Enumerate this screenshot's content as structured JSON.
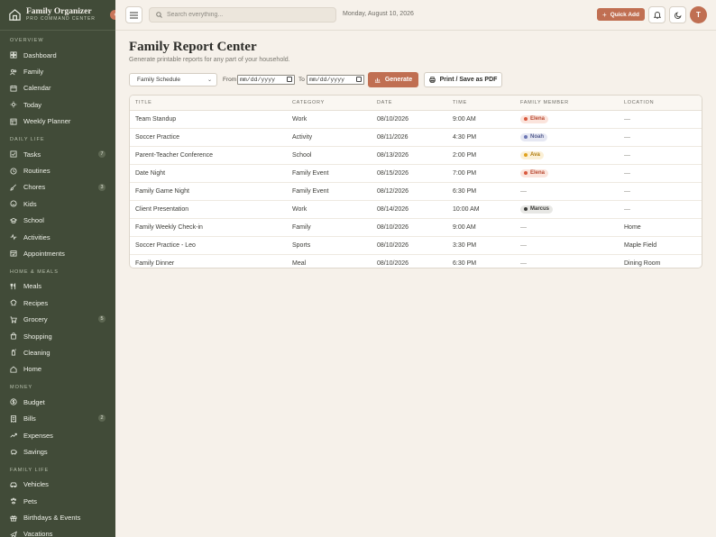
{
  "brand": {
    "title": "Family Organizer",
    "subtitle": "PRO COMMAND CENTER"
  },
  "sidebar": {
    "sections": [
      {
        "label": "OVERVIEW",
        "items": [
          {
            "label": "Dashboard",
            "icon": "grid-icon"
          },
          {
            "label": "Family",
            "icon": "users-icon"
          },
          {
            "label": "Calendar",
            "icon": "calendar-icon"
          },
          {
            "label": "Today",
            "icon": "sun-icon"
          },
          {
            "label": "Weekly Planner",
            "icon": "planner-icon"
          }
        ]
      },
      {
        "label": "DAILY LIFE",
        "items": [
          {
            "label": "Tasks",
            "icon": "checkbox-icon",
            "badge": "7"
          },
          {
            "label": "Routines",
            "icon": "clock-icon"
          },
          {
            "label": "Chores",
            "icon": "brush-icon",
            "badge": "3"
          },
          {
            "label": "Kids",
            "icon": "smile-icon"
          },
          {
            "label": "School",
            "icon": "school-icon"
          },
          {
            "label": "Activities",
            "icon": "activity-icon"
          },
          {
            "label": "Appointments",
            "icon": "appointment-icon"
          }
        ]
      },
      {
        "label": "HOME & MEALS",
        "items": [
          {
            "label": "Meals",
            "icon": "utensils-icon"
          },
          {
            "label": "Recipes",
            "icon": "chef-icon"
          },
          {
            "label": "Grocery",
            "icon": "cart-icon",
            "badge": "5"
          },
          {
            "label": "Shopping",
            "icon": "bag-icon"
          },
          {
            "label": "Cleaning",
            "icon": "spray-icon"
          },
          {
            "label": "Home",
            "icon": "home-icon"
          }
        ]
      },
      {
        "label": "MONEY",
        "items": [
          {
            "label": "Budget",
            "icon": "dollar-icon"
          },
          {
            "label": "Bills",
            "icon": "receipt-icon",
            "badge": "2"
          },
          {
            "label": "Expenses",
            "icon": "trending-icon"
          },
          {
            "label": "Savings",
            "icon": "piggy-icon"
          }
        ]
      },
      {
        "label": "FAMILY LIFE",
        "items": [
          {
            "label": "Vehicles",
            "icon": "car-icon"
          },
          {
            "label": "Pets",
            "icon": "paw-icon"
          },
          {
            "label": "Birthdays & Events",
            "icon": "gift-icon"
          },
          {
            "label": "Vacations",
            "icon": "plane-icon"
          }
        ]
      }
    ]
  },
  "topbar": {
    "search_placeholder": "Search everything...",
    "date": "Monday, August 10, 2026",
    "quick_add": "Quick Add",
    "avatar": "T"
  },
  "page": {
    "title": "Family Report Center",
    "subtitle": "Generate printable reports for any part of your household.",
    "report_type": "Family Schedule",
    "from_label": "From",
    "to_label": "To",
    "date_placeholder": "mm/dd/yyyy",
    "generate": "Generate",
    "print": "Print / Save as PDF"
  },
  "table": {
    "columns": [
      "TITLE",
      "CATEGORY",
      "DATE",
      "TIME",
      "FAMILY MEMBER",
      "LOCATION"
    ],
    "rows": [
      {
        "title": "Team Standup",
        "category": "Work",
        "date": "08/10/2026",
        "time": "9:00 AM",
        "member": "Elena",
        "location": "—"
      },
      {
        "title": "Soccer Practice",
        "category": "Activity",
        "date": "08/11/2026",
        "time": "4:30 PM",
        "member": "Noah",
        "location": "—"
      },
      {
        "title": "Parent-Teacher Conference",
        "category": "School",
        "date": "08/13/2026",
        "time": "2:00 PM",
        "member": "Ava",
        "location": "—"
      },
      {
        "title": "Date Night",
        "category": "Family Event",
        "date": "08/15/2026",
        "time": "7:00 PM",
        "member": "Elena",
        "location": "—"
      },
      {
        "title": "Family Game Night",
        "category": "Family Event",
        "date": "08/12/2026",
        "time": "6:30 PM",
        "member": "—",
        "location": "—"
      },
      {
        "title": "Client Presentation",
        "category": "Work",
        "date": "08/14/2026",
        "time": "10:00 AM",
        "member": "Marcus",
        "location": "—"
      },
      {
        "title": "Family Weekly Check-in",
        "category": "Family",
        "date": "08/10/2026",
        "time": "9:00 AM",
        "member": "—",
        "location": "Home"
      },
      {
        "title": "Soccer Practice - Leo",
        "category": "Sports",
        "date": "08/10/2026",
        "time": "3:30 PM",
        "member": "—",
        "location": "Maple Field"
      },
      {
        "title": "Family Dinner",
        "category": "Meal",
        "date": "08/10/2026",
        "time": "6:30 PM",
        "member": "—",
        "location": "Dining Room"
      }
    ]
  },
  "member_colors": {
    "Elena": {
      "bg": "#fbe4dc",
      "dot": "#d9583d",
      "fg": "#b84a33"
    },
    "Noah": {
      "bg": "#e6e8f3",
      "dot": "#6b76b3",
      "fg": "#535c8e"
    },
    "Ava": {
      "bg": "#fbf0d6",
      "dot": "#e0a11b",
      "fg": "#b07d10"
    },
    "Marcus": {
      "bg": "#e7e7e4",
      "dot": "#3b3b38",
      "fg": "#3b3b38"
    }
  }
}
